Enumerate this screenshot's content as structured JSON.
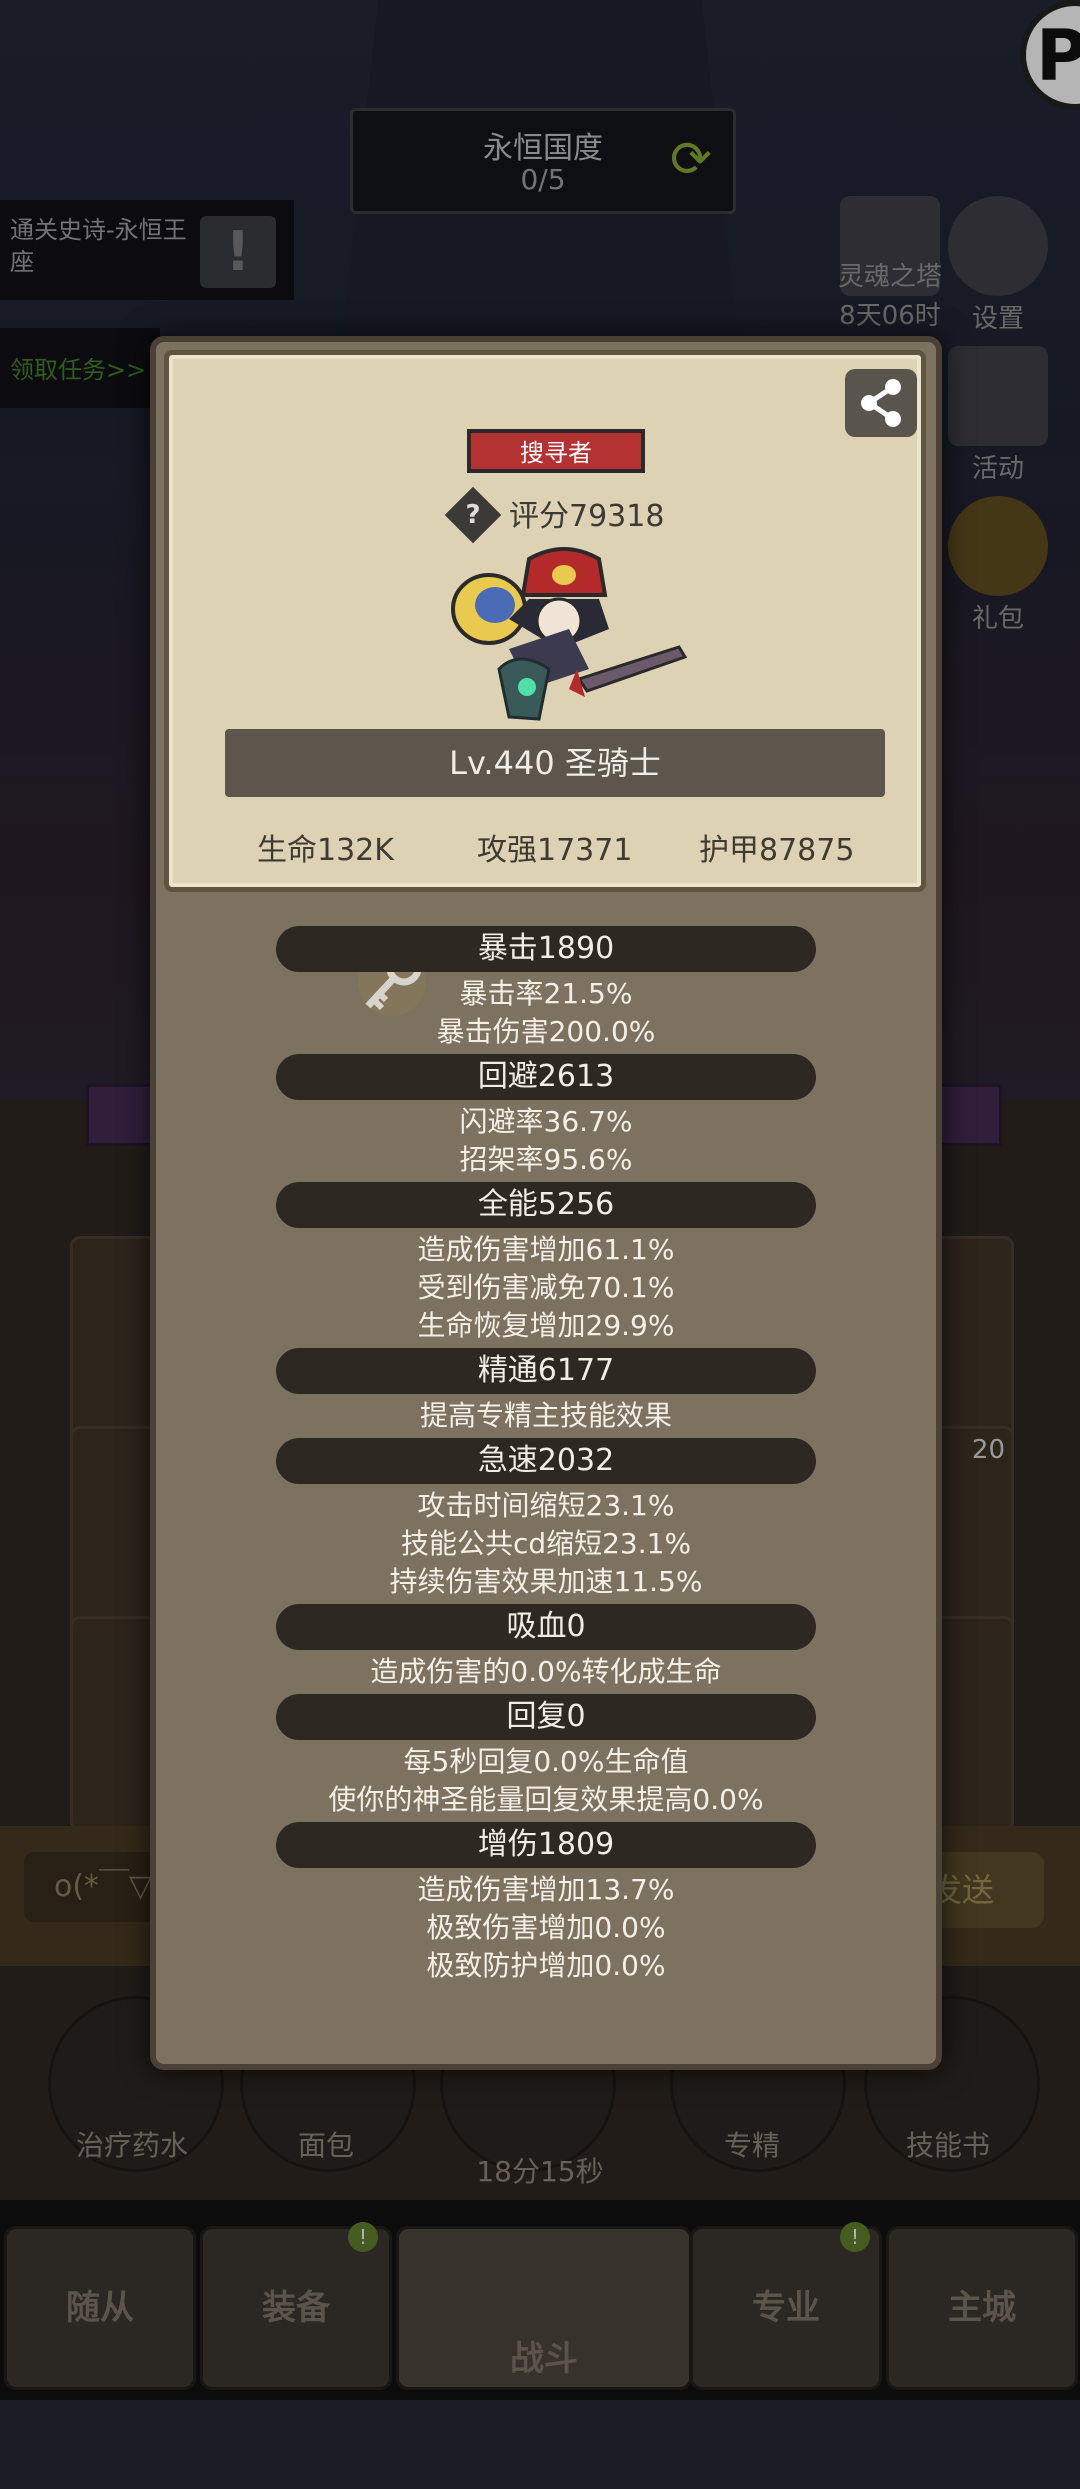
{
  "background": {
    "realm_title": "永恒国度",
    "realm_progress": "0/5",
    "quest_text": "通关史诗-永恒王座",
    "quest_claim": "领取任务>>",
    "right_menu": [
      {
        "label": "设置",
        "icon": "gear-icon"
      },
      {
        "label": "活动",
        "icon": "calendar-icon"
      },
      {
        "label": "礼包",
        "icon": "gift-icon"
      }
    ],
    "tower_title": "灵魂之塔",
    "tower_timer": "8天06时",
    "chat_placeholder": "o(*￣▽",
    "send_label": "发送",
    "quick_items": [
      {
        "label": "治疗药水"
      },
      {
        "label": "面包"
      },
      {
        "label": "18分15秒"
      },
      {
        "label": "专精"
      },
      {
        "label": "技能书"
      }
    ],
    "skill_badge": "20",
    "nav": [
      {
        "label": "随从"
      },
      {
        "label": "装备"
      },
      {
        "label": "战斗"
      },
      {
        "label": "专业"
      },
      {
        "label": "主城"
      }
    ],
    "nav_badge": "!"
  },
  "profile": {
    "class_tag": "搜寻者",
    "score": "评分79318",
    "level": "Lv.440 圣骑士",
    "hp": "生命132K",
    "attack": "攻强17371",
    "armor": "护甲87875"
  },
  "stats": [
    {
      "title": "暴击1890",
      "lines": [
        "暴击率21.5%",
        "暴击伤害200.0%"
      ]
    },
    {
      "title": "回避2613",
      "lines": [
        "闪避率36.7%",
        "招架率95.6%"
      ]
    },
    {
      "title": "全能5256",
      "lines": [
        "造成伤害增加61.1%",
        "受到伤害减免70.1%",
        "生命恢复增加29.9%"
      ]
    },
    {
      "title": "精通6177",
      "lines": [
        "提高专精主技能效果"
      ]
    },
    {
      "title": "急速2032",
      "lines": [
        "攻击时间缩短23.1%",
        "技能公共cd缩短23.1%",
        "持续伤害效果加速11.5%"
      ]
    },
    {
      "title": "吸血0",
      "lines": [
        "造成伤害的0.0%转化成生命"
      ]
    },
    {
      "title": "回复0",
      "lines": [
        "每5秒回复0.0%生命值",
        "使你的神圣能量回复效果提高0.0%"
      ]
    },
    {
      "title": "增伤1809",
      "lines": [
        "造成伤害增加13.7%",
        "极致伤害增加0.0%",
        "极致防护增加0.0%"
      ]
    }
  ],
  "colors": {
    "modal_bg": "#7d725f",
    "card_bg": "#ddd2b4",
    "tag_red": "#b43232",
    "section_bar": "#2d2822"
  }
}
